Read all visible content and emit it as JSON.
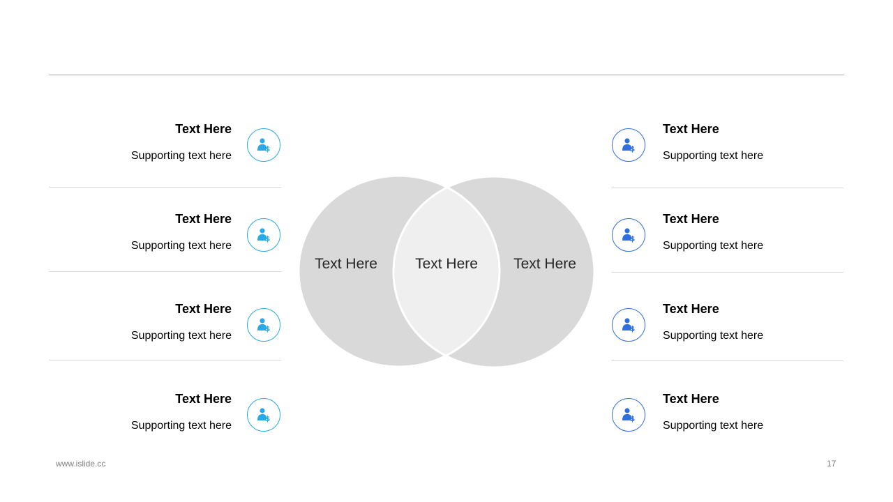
{
  "left_items": [
    {
      "title": "Text Here",
      "subtitle": "Supporting text here",
      "icon": "user-dollar-icon"
    },
    {
      "title": "Text Here",
      "subtitle": "Supporting text here",
      "icon": "user-dollar-icon"
    },
    {
      "title": "Text Here",
      "subtitle": "Supporting text here",
      "icon": "user-dollar-icon"
    },
    {
      "title": "Text Here",
      "subtitle": "Supporting text here",
      "icon": "user-dollar-icon"
    }
  ],
  "right_items": [
    {
      "title": "Text Here",
      "subtitle": "Supporting text here",
      "icon": "user-dollar-icon"
    },
    {
      "title": "Text Here",
      "subtitle": "Supporting text here",
      "icon": "user-dollar-icon"
    },
    {
      "title": "Text Here",
      "subtitle": "Supporting text here",
      "icon": "user-dollar-icon"
    },
    {
      "title": "Text Here",
      "subtitle": "Supporting text here",
      "icon": "user-dollar-icon"
    }
  ],
  "venn": {
    "left_label": "Text Here",
    "center_label": "Text Here",
    "right_label": "Text Here"
  },
  "footer": {
    "url": "www.islide.cc",
    "page_number": "17"
  },
  "colors": {
    "left_accent": "#29a9e8",
    "right_accent": "#2f6fdd",
    "circle_fill": "#d9d9d9",
    "overlap_fill": "#efefef"
  }
}
